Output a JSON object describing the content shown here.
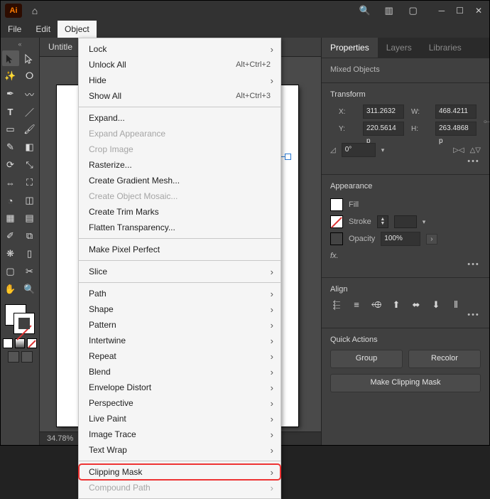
{
  "app": {
    "logo_text": "Ai"
  },
  "menubar": {
    "file": "File",
    "edit": "Edit",
    "object": "Object"
  },
  "doc": {
    "tab": "Untitle"
  },
  "status": {
    "zoom": "34.78%"
  },
  "menu": {
    "items": [
      {
        "label": "Lock",
        "sub": true,
        "dis": false
      },
      {
        "label": "Unlock All",
        "shortcut": "Alt+Ctrl+2",
        "dis": false
      },
      {
        "label": "Hide",
        "sub": true,
        "dis": false
      },
      {
        "label": "Show All",
        "shortcut": "Alt+Ctrl+3",
        "dis": false
      },
      {
        "sep": true
      },
      {
        "label": "Expand...",
        "dis": false
      },
      {
        "label": "Expand Appearance",
        "dis": true
      },
      {
        "label": "Crop Image",
        "dis": true
      },
      {
        "label": "Rasterize...",
        "dis": false
      },
      {
        "label": "Create Gradient Mesh...",
        "dis": false
      },
      {
        "label": "Create Object Mosaic...",
        "dis": true
      },
      {
        "label": "Create Trim Marks",
        "dis": false
      },
      {
        "label": "Flatten Transparency...",
        "dis": false
      },
      {
        "sep": true
      },
      {
        "label": "Make Pixel Perfect",
        "dis": false
      },
      {
        "sep": true
      },
      {
        "label": "Slice",
        "sub": true,
        "dis": false
      },
      {
        "sep": true
      },
      {
        "label": "Path",
        "sub": true,
        "dis": false
      },
      {
        "label": "Shape",
        "sub": true,
        "dis": false
      },
      {
        "label": "Pattern",
        "sub": true,
        "dis": false
      },
      {
        "label": "Intertwine",
        "sub": true,
        "dis": false
      },
      {
        "label": "Repeat",
        "sub": true,
        "dis": false
      },
      {
        "label": "Blend",
        "sub": true,
        "dis": false
      },
      {
        "label": "Envelope Distort",
        "sub": true,
        "dis": false
      },
      {
        "label": "Perspective",
        "sub": true,
        "dis": false
      },
      {
        "label": "Live Paint",
        "sub": true,
        "dis": false
      },
      {
        "label": "Image Trace",
        "sub": true,
        "dis": false
      },
      {
        "label": "Text Wrap",
        "sub": true,
        "dis": false
      },
      {
        "sep": true
      },
      {
        "label": "Clipping Mask",
        "sub": true,
        "dis": false,
        "hl": true
      },
      {
        "label": "Compound Path",
        "sub": true,
        "dis": true
      }
    ]
  },
  "panel": {
    "tabs": {
      "properties": "Properties",
      "layers": "Layers",
      "libraries": "Libraries"
    },
    "selection": "Mixed Objects",
    "transform": {
      "title": "Transform",
      "xl": "X:",
      "x": "311.2632 p",
      "yl": "Y:",
      "y": "220.5614 p",
      "wl": "W:",
      "w": "468.4211 p",
      "hl": "H:",
      "h": "263.4868 p",
      "rot": "0°",
      "flip": "⇋"
    },
    "appearance": {
      "title": "Appearance",
      "fill": "Fill",
      "stroke": "Stroke",
      "opacity": "Opacity",
      "opval": "100%",
      "fx": "fx."
    },
    "align": {
      "title": "Align"
    },
    "quick": {
      "title": "Quick Actions",
      "group": "Group",
      "recolor": "Recolor",
      "clip": "Make Clipping Mask"
    }
  }
}
